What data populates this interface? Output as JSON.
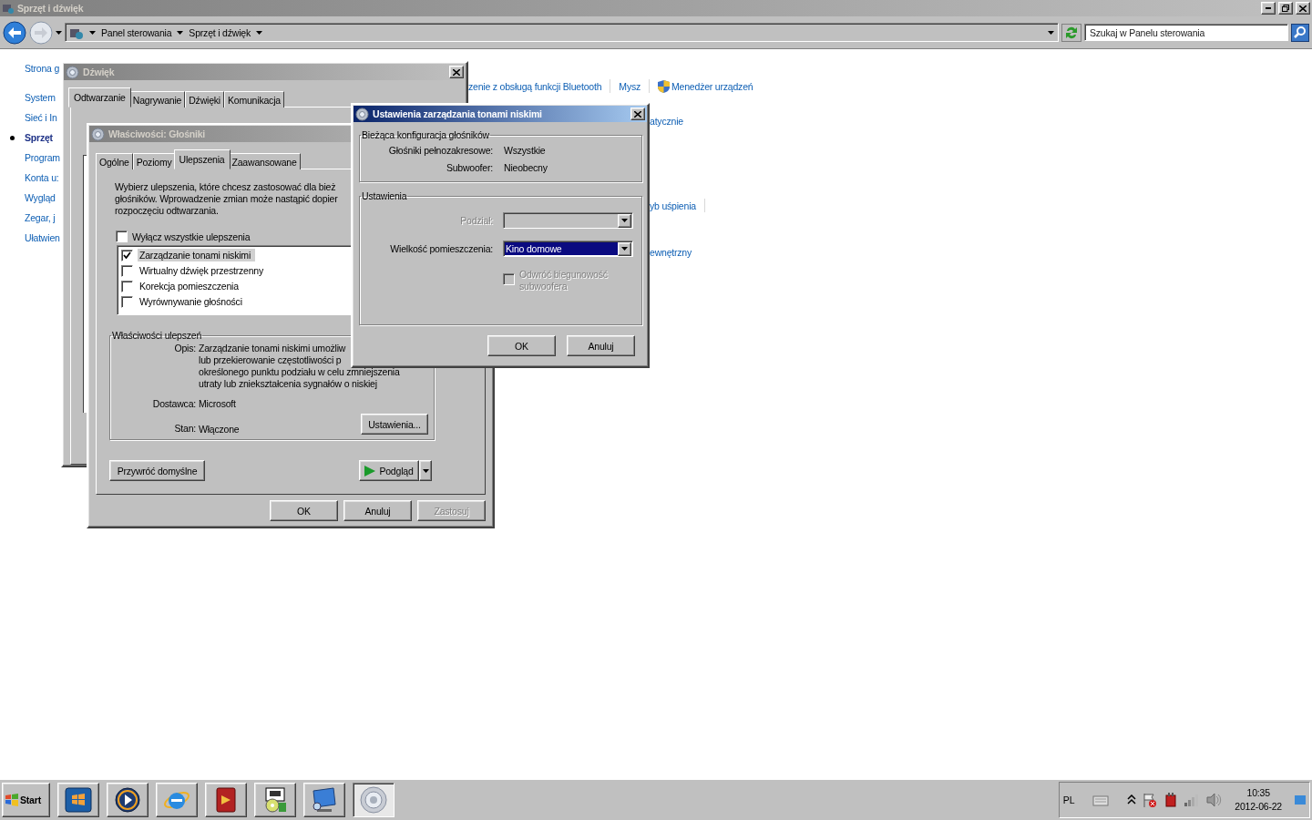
{
  "explorer": {
    "title": "Sprzęt i dźwięk",
    "breadcrumbs": [
      "Panel sterowania",
      "Sprzęt i dźwięk"
    ],
    "search": {
      "placeholder": "Szukaj w Panelu sterowania"
    },
    "nav": [
      {
        "label": "Strona g",
        "selected": false
      },
      {
        "label": "System",
        "selected": false
      },
      {
        "label": "Sieć i In",
        "selected": false
      },
      {
        "label": "Sprzęt",
        "selected": true
      },
      {
        "label": "Program",
        "selected": false
      },
      {
        "label": "Konta u:",
        "selected": false
      },
      {
        "label": "Wygląd",
        "selected": false
      },
      {
        "label": "Zegar, j",
        "selected": false
      },
      {
        "label": "Ułatwien",
        "selected": false
      }
    ],
    "link_rows": [
      {
        "trailing_separator": false,
        "links": [
          {
            "text": "zenie z obsługą funkcji Bluetooth",
            "shield": false
          },
          {
            "text": "Mysz",
            "shield": false
          },
          {
            "text": "Menedżer urządzeń",
            "shield": true
          }
        ]
      },
      {
        "trailing_separator": false,
        "links": [
          {
            "text": "atycznie",
            "shield": false
          }
        ]
      },
      {
        "trailing_separator": true,
        "links": [
          {
            "text": "yb uśpienia",
            "shield": false
          }
        ]
      },
      {
        "trailing_separator": false,
        "links": [
          {
            "text": "ewnętrzny",
            "shield": false
          }
        ]
      }
    ]
  },
  "sound_window": {
    "title": "Dźwięk",
    "tabs": [
      {
        "label": "Odtwarzanie",
        "selected": true
      },
      {
        "label": "Nagrywanie",
        "selected": false
      },
      {
        "label": "Dźwięki",
        "selected": false
      },
      {
        "label": "Komunikacja",
        "selected": false
      }
    ]
  },
  "properties": {
    "title": "Właściwości: Głośniki",
    "tabs": [
      {
        "label": "Ogólne",
        "selected": false
      },
      {
        "label": "Poziomy",
        "selected": false
      },
      {
        "label": "Ulepszenia",
        "selected": true
      },
      {
        "label": "Zaawansowane",
        "selected": false
      }
    ],
    "intro": [
      "Wybierz ulepszenia, które chcesz zastosować dla bież",
      "głośników. Wprowadzenie zmian może nastąpić dopier",
      "rozpoczęciu odtwarzania."
    ],
    "disable_all": {
      "label": "Wyłącz wszystkie ulepszenia",
      "checked": false
    },
    "enhancements": [
      {
        "label": "Zarządzanie tonami niskimi",
        "checked": true,
        "selected": true
      },
      {
        "label": "Wirtualny dźwięk przestrzenny",
        "checked": false,
        "selected": false
      },
      {
        "label": "Korekcja pomieszczenia",
        "checked": false,
        "selected": false
      },
      {
        "label": "Wyrównywanie głośności",
        "checked": false,
        "selected": false
      }
    ],
    "group": {
      "title": "Właściwości ulepszeń",
      "description_label": "Opis:",
      "description": [
        "Zarządzanie tonami niskimi umożliw",
        "lub przekierowanie częstotliwości p",
        "określonego punktu podziału w celu zmniejszenia",
        "utraty lub zniekształcenia sygnałów o niskiej"
      ],
      "vendor_label": "Dostawca:",
      "vendor": "Microsoft",
      "state_label": "Stan:",
      "state": "Włączone",
      "settings_button": "Ustawienia..."
    },
    "restore_button": "Przywróć domyślne",
    "preview_button": "Podgląd",
    "buttons": [
      {
        "label": "OK",
        "disabled": false
      },
      {
        "label": "Anuluj",
        "disabled": false
      },
      {
        "label": "Zastosuj",
        "disabled": true
      }
    ]
  },
  "bass_dialog": {
    "title": "Ustawienia zarządzania tonami niskimi",
    "config_group": {
      "title": "Bieżąca konfiguracja głośników",
      "rows": [
        {
          "label": "Głośniki pełnozakresowe:",
          "value": "Wszystkie"
        },
        {
          "label": "Subwoofer:",
          "value": "Nieobecny"
        }
      ]
    },
    "settings_group": {
      "title": "Ustawienia",
      "crossover": {
        "label": "Podział:",
        "disabled": true
      },
      "room_size": {
        "label": "Wielkość pomieszczenia:",
        "value": "Kino domowe",
        "disabled": false
      },
      "invert": {
        "label": "Odwróć biegunowość subwoofera",
        "checked": false,
        "disabled": true
      }
    },
    "buttons": [
      "OK",
      "Anuluj"
    ]
  },
  "taskbar": {
    "start": "Start",
    "tasks": [
      {
        "kind": "windows",
        "selected": false
      },
      {
        "kind": "media",
        "selected": false
      },
      {
        "kind": "browser",
        "selected": false
      },
      {
        "kind": "book",
        "selected": false
      },
      {
        "kind": "installer",
        "selected": false
      },
      {
        "kind": "monitor",
        "selected": false
      },
      {
        "kind": "speaker",
        "selected": true
      }
    ],
    "language": "PL",
    "time": "10:35",
    "date": "2012-06-22"
  }
}
